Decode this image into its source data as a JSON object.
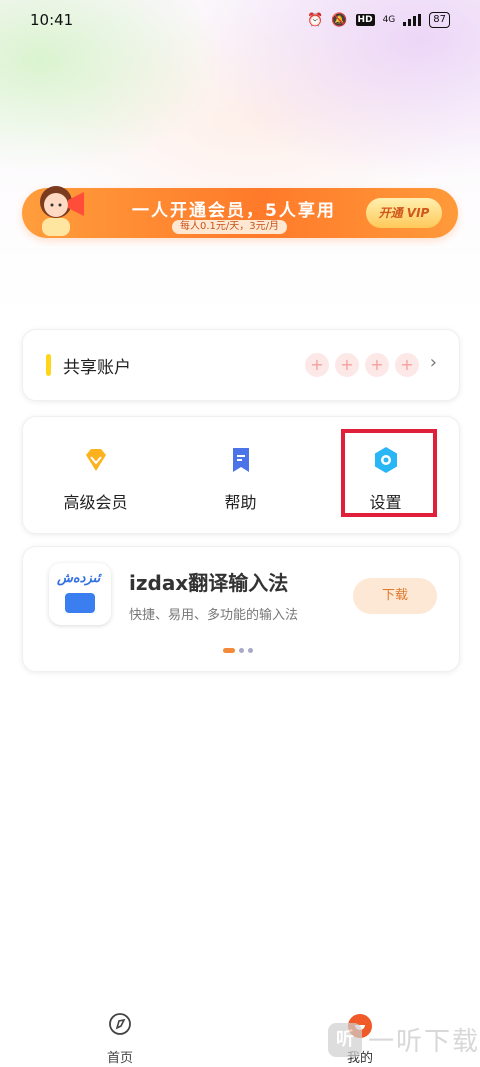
{
  "status_bar": {
    "time": "10:41",
    "network": "4G",
    "battery": "87",
    "hd": "HD"
  },
  "banner": {
    "title": "一人开通会员，5人享用",
    "subtitle": "每人0.1元/天，3元/月",
    "button": "开通 VIP"
  },
  "share_account": {
    "title": "共享账户",
    "slot_symbol": "+",
    "slots": 4,
    "chevron": "›"
  },
  "menu": {
    "items": [
      {
        "label": "高级会员",
        "icon": "diamond-icon"
      },
      {
        "label": "帮助",
        "icon": "bookmark-icon"
      },
      {
        "label": "设置",
        "icon": "hexagon-settings-icon"
      }
    ]
  },
  "app_promo": {
    "name": "izdax翻译输入法",
    "description": "快捷、易用、多功能的输入法",
    "button": "下载",
    "icon_text": "ئىزدەش"
  },
  "tabs": [
    {
      "label": "首页",
      "icon": "home-compass-icon"
    },
    {
      "label": "我的",
      "icon": "profile-icon"
    }
  ],
  "watermark": {
    "logo": "听",
    "text": "一听下载"
  },
  "colors": {
    "accent": "#ff7a2a",
    "highlight_box": "#e0203a"
  }
}
